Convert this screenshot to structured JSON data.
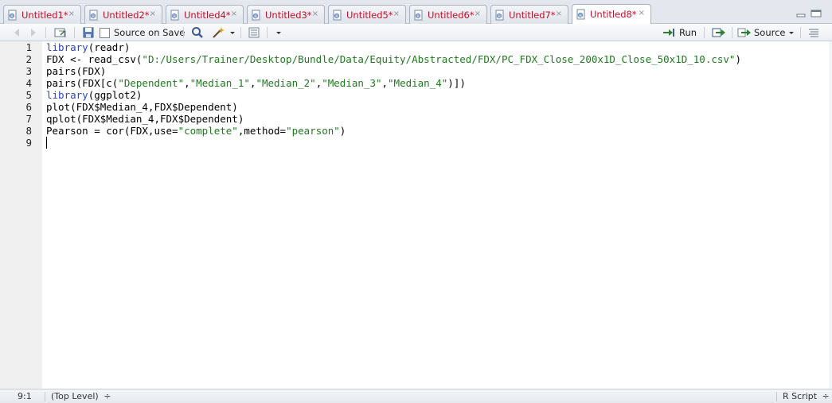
{
  "tabs": [
    {
      "label": "Untitled1*",
      "close": "×",
      "active": false
    },
    {
      "label": "Untitled2*",
      "close": "×",
      "active": false
    },
    {
      "label": "Untitled4*",
      "close": "×",
      "active": false
    },
    {
      "label": "Untitled3*",
      "close": "×",
      "active": false
    },
    {
      "label": "Untitled5*",
      "close": "×",
      "active": false
    },
    {
      "label": "Untitled6*",
      "close": "×",
      "active": false
    },
    {
      "label": "Untitled7*",
      "close": "×",
      "active": false
    },
    {
      "label": "Untitled8*",
      "close": "×",
      "active": true
    }
  ],
  "toolbar": {
    "source_on_save_label": "Source on Save",
    "run_label": "Run",
    "source_label": "Source"
  },
  "editor": {
    "line_numbers": [
      "1",
      "2",
      "3",
      "4",
      "5",
      "6",
      "7",
      "8",
      "9"
    ],
    "lines": [
      [
        {
          "t": "library",
          "c": "kw"
        },
        {
          "t": "(readr)",
          "c": ""
        }
      ],
      [
        {
          "t": "FDX <- read_csv(",
          "c": ""
        },
        {
          "t": "\"D:/Users/Trainer/Desktop/Bundle/Data/Equity/Abstracted/FDX/PC_FDX_Close_200x1D_Close_50x1D_10.csv\"",
          "c": "str"
        },
        {
          "t": ")",
          "c": ""
        }
      ],
      [
        {
          "t": "pairs(FDX)",
          "c": ""
        }
      ],
      [
        {
          "t": "pairs(FDX[c(",
          "c": ""
        },
        {
          "t": "\"Dependent\"",
          "c": "str"
        },
        {
          "t": ",",
          "c": ""
        },
        {
          "t": "\"Median_1\"",
          "c": "str"
        },
        {
          "t": ",",
          "c": ""
        },
        {
          "t": "\"Median_2\"",
          "c": "str"
        },
        {
          "t": ",",
          "c": ""
        },
        {
          "t": "\"Median_3\"",
          "c": "str"
        },
        {
          "t": ",",
          "c": ""
        },
        {
          "t": "\"Median_4\"",
          "c": "str"
        },
        {
          "t": ")])",
          "c": ""
        }
      ],
      [
        {
          "t": "library",
          "c": "kw"
        },
        {
          "t": "(ggplot2)",
          "c": ""
        }
      ],
      [
        {
          "t": "plot(FDX$Median_4,FDX$Dependent)",
          "c": ""
        }
      ],
      [
        {
          "t": "qplot(FDX$Median_4,FDX$Dependent)",
          "c": ""
        }
      ],
      [
        {
          "t": "Pearson = cor(FDX,use=",
          "c": ""
        },
        {
          "t": "\"complete\"",
          "c": "str"
        },
        {
          "t": ",method=",
          "c": ""
        },
        {
          "t": "\"pearson\"",
          "c": "str"
        },
        {
          "t": ")",
          "c": ""
        }
      ],
      []
    ]
  },
  "status": {
    "position": "9:1",
    "scope": "(Top Level)",
    "scope_arrow": "÷",
    "language": "R Script",
    "language_arrow": "÷"
  }
}
